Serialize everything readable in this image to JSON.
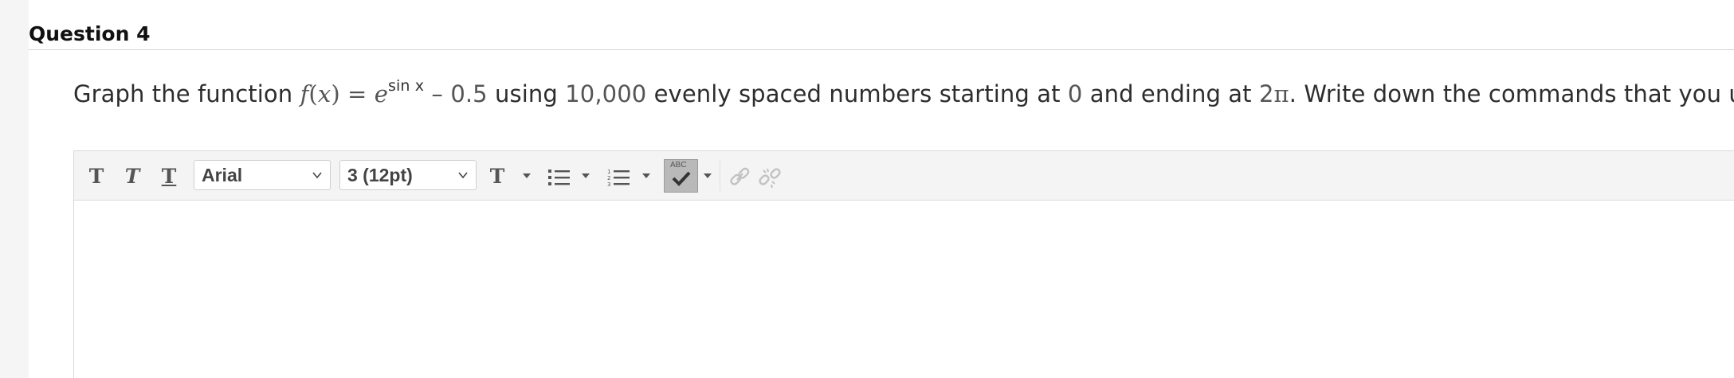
{
  "question": {
    "title": "Question 4",
    "text_before": "Graph the function ",
    "func_f": "f",
    "func_paren_open": "(",
    "func_x": "x",
    "func_paren_close": ")",
    "equals": " = ",
    "func_e": "e",
    "exponent": "sin x",
    "minus": " – ",
    "constant": "0.5",
    "text_using": " using ",
    "count": "10,000",
    "text_evenly": " evenly spaced numbers starting at ",
    "start": "0",
    "text_ending": " and ending at ",
    "end_number": "2",
    "end_pi": "π",
    "text_after": ". Write down the commands that you used."
  },
  "toolbar": {
    "bold_glyph": "T",
    "italic_glyph": "T",
    "underline_glyph": "T",
    "font_family": "Arial",
    "font_size": "3 (12pt)",
    "text_color_glyph": "T",
    "spellcheck_label": "ABC"
  },
  "editor": {
    "content": ""
  },
  "colors": {
    "toolbar_bg": "#f4f4f4",
    "border": "#d9d9d9",
    "gutter": "#f5f5f5",
    "spell_active": "#b9b9b9"
  }
}
